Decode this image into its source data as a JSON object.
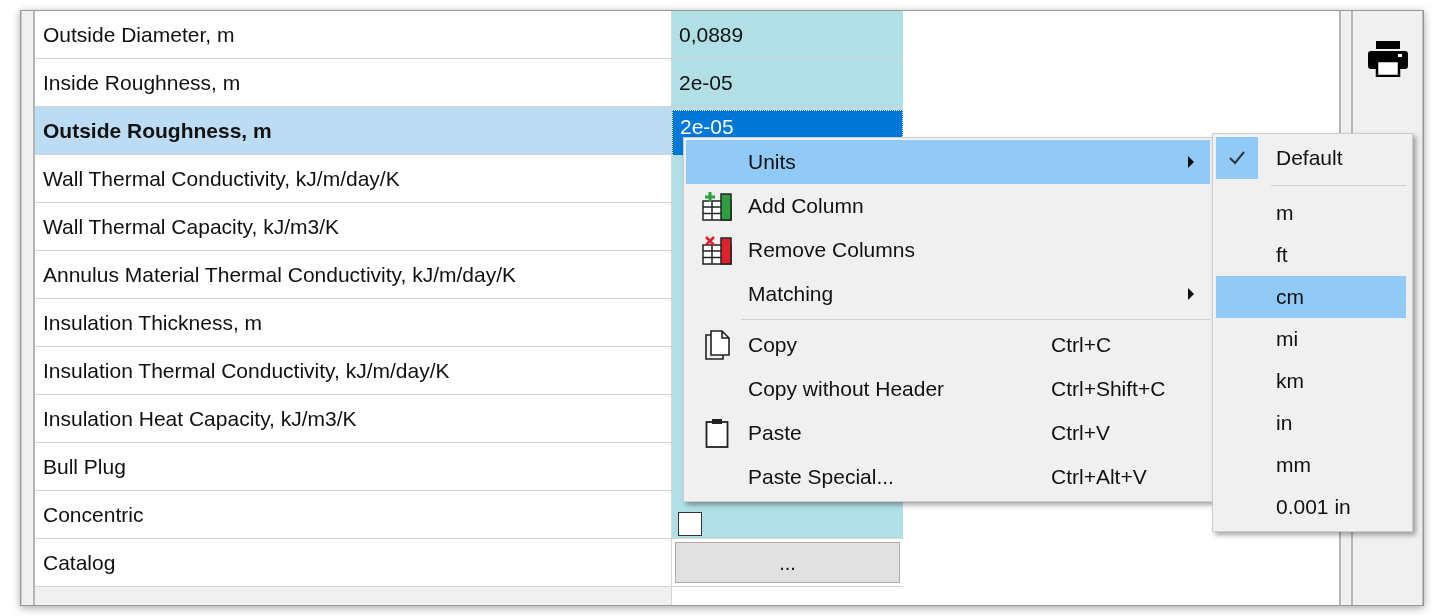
{
  "grid": {
    "rows": [
      {
        "label": "Outside Diameter, m",
        "kind": "text",
        "value": "0,0889",
        "selected": false
      },
      {
        "label": "Inside Roughness, m",
        "kind": "text",
        "value": "2e-05",
        "selected": false
      },
      {
        "label": "Outside Roughness, m",
        "kind": "text",
        "value": "2e-05",
        "selected": true
      },
      {
        "label": "Wall Thermal Conductivity, kJ/m/day/K",
        "kind": "text",
        "selected": false
      },
      {
        "label": "Wall Thermal Capacity, kJ/m3/K",
        "kind": "text",
        "selected": false
      },
      {
        "label": "Annulus Material Thermal Conductivity, kJ/m/day/K",
        "kind": "text",
        "selected": false
      },
      {
        "label": "Insulation Thickness, m",
        "kind": "text",
        "selected": false
      },
      {
        "label": "Insulation Thermal Conductivity, kJ/m/day/K",
        "kind": "text",
        "selected": false
      },
      {
        "label": "Insulation Heat Capacity, kJ/m3/K",
        "kind": "text",
        "selected": false
      },
      {
        "label": "Bull Plug",
        "kind": "text",
        "selected": false
      },
      {
        "label": "Concentric",
        "kind": "checkbox",
        "checked": false,
        "selected": false
      },
      {
        "label": "Catalog",
        "kind": "button",
        "value": "...",
        "selected": false
      }
    ]
  },
  "context_menu": {
    "items": [
      {
        "kind": "plain",
        "label": "Units",
        "submenu": true,
        "selected": true
      },
      {
        "kind": "add-column",
        "label": "Add Column",
        "submenu": false,
        "selected": false
      },
      {
        "kind": "remove-columns",
        "label": "Remove Columns",
        "submenu": false,
        "selected": false
      },
      {
        "kind": "plain",
        "label": "Matching",
        "submenu": true,
        "selected": false
      },
      {
        "kind": "separator"
      },
      {
        "kind": "copy",
        "label": "Copy",
        "shortcut": "Ctrl+C",
        "submenu": false,
        "selected": false
      },
      {
        "kind": "plain",
        "label": "Copy without Header",
        "shortcut": "Ctrl+Shift+C",
        "submenu": false,
        "selected": false
      },
      {
        "kind": "paste",
        "label": "Paste",
        "shortcut": "Ctrl+V",
        "submenu": false,
        "selected": false
      },
      {
        "kind": "plain",
        "label": "Paste Special...",
        "shortcut": "Ctrl+Alt+V",
        "submenu": false,
        "selected": false
      }
    ]
  },
  "units_submenu": {
    "items": [
      {
        "kind": "item",
        "label": "Default",
        "checked": true,
        "selected": false
      },
      {
        "kind": "separator"
      },
      {
        "kind": "item",
        "label": "m",
        "checked": false,
        "selected": false
      },
      {
        "kind": "item",
        "label": "ft",
        "checked": false,
        "selected": false
      },
      {
        "kind": "item",
        "label": "cm",
        "checked": false,
        "selected": true
      },
      {
        "kind": "item",
        "label": "mi",
        "checked": false,
        "selected": false
      },
      {
        "kind": "item",
        "label": "km",
        "checked": false,
        "selected": false
      },
      {
        "kind": "item",
        "label": "in",
        "checked": false,
        "selected": false
      },
      {
        "kind": "item",
        "label": "mm",
        "checked": false,
        "selected": false
      },
      {
        "kind": "item",
        "label": "0.001 in",
        "checked": false,
        "selected": false
      }
    ]
  }
}
